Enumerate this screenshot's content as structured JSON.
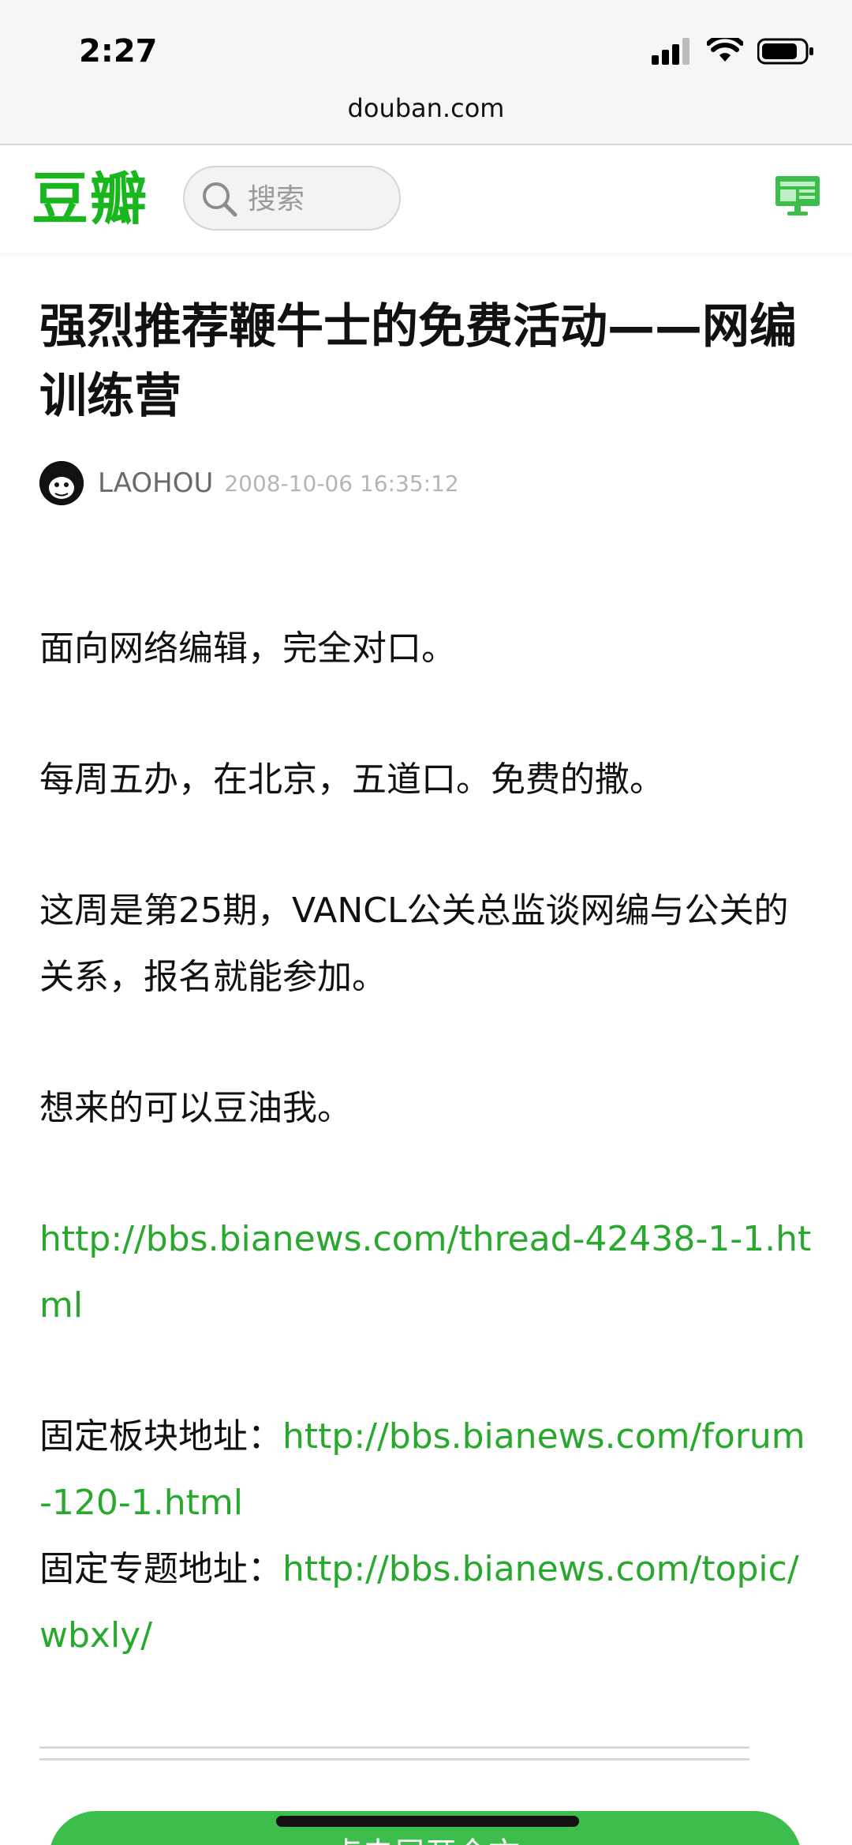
{
  "status_bar": {
    "time": "2:27"
  },
  "browser": {
    "url": "douban.com"
  },
  "header": {
    "logo": "豆瓣",
    "search_placeholder": "搜索"
  },
  "article": {
    "title": "强烈推荐鞭牛士的免费活动——网编训练营",
    "author": "LAOHOU",
    "date": "2008-10-06 16:35:12",
    "paragraphs": [
      "面向网络编辑，完全对口。",
      "每周五办，在北京，五道口。免费的撒。",
      "这周是第25期，VANCL公关总监谈网编与公关的关系，报名就能参加。",
      "想来的可以豆油我。"
    ],
    "link1": "http://bbs.bianews.com/thread-42438-1-1.html",
    "board_label": "固定板块地址：",
    "board_link": "http://bbs.bianews.com/forum-120-1.html",
    "topic_label": "固定专题地址：",
    "topic_link": "http://bbs.bianews.com/topic/wbxly/"
  },
  "cta": {
    "label": "点击展开全文"
  },
  "colors": {
    "brand_green": "#19b61d",
    "link_green": "#29a82e",
    "cta_green": "#3dbd4b"
  }
}
